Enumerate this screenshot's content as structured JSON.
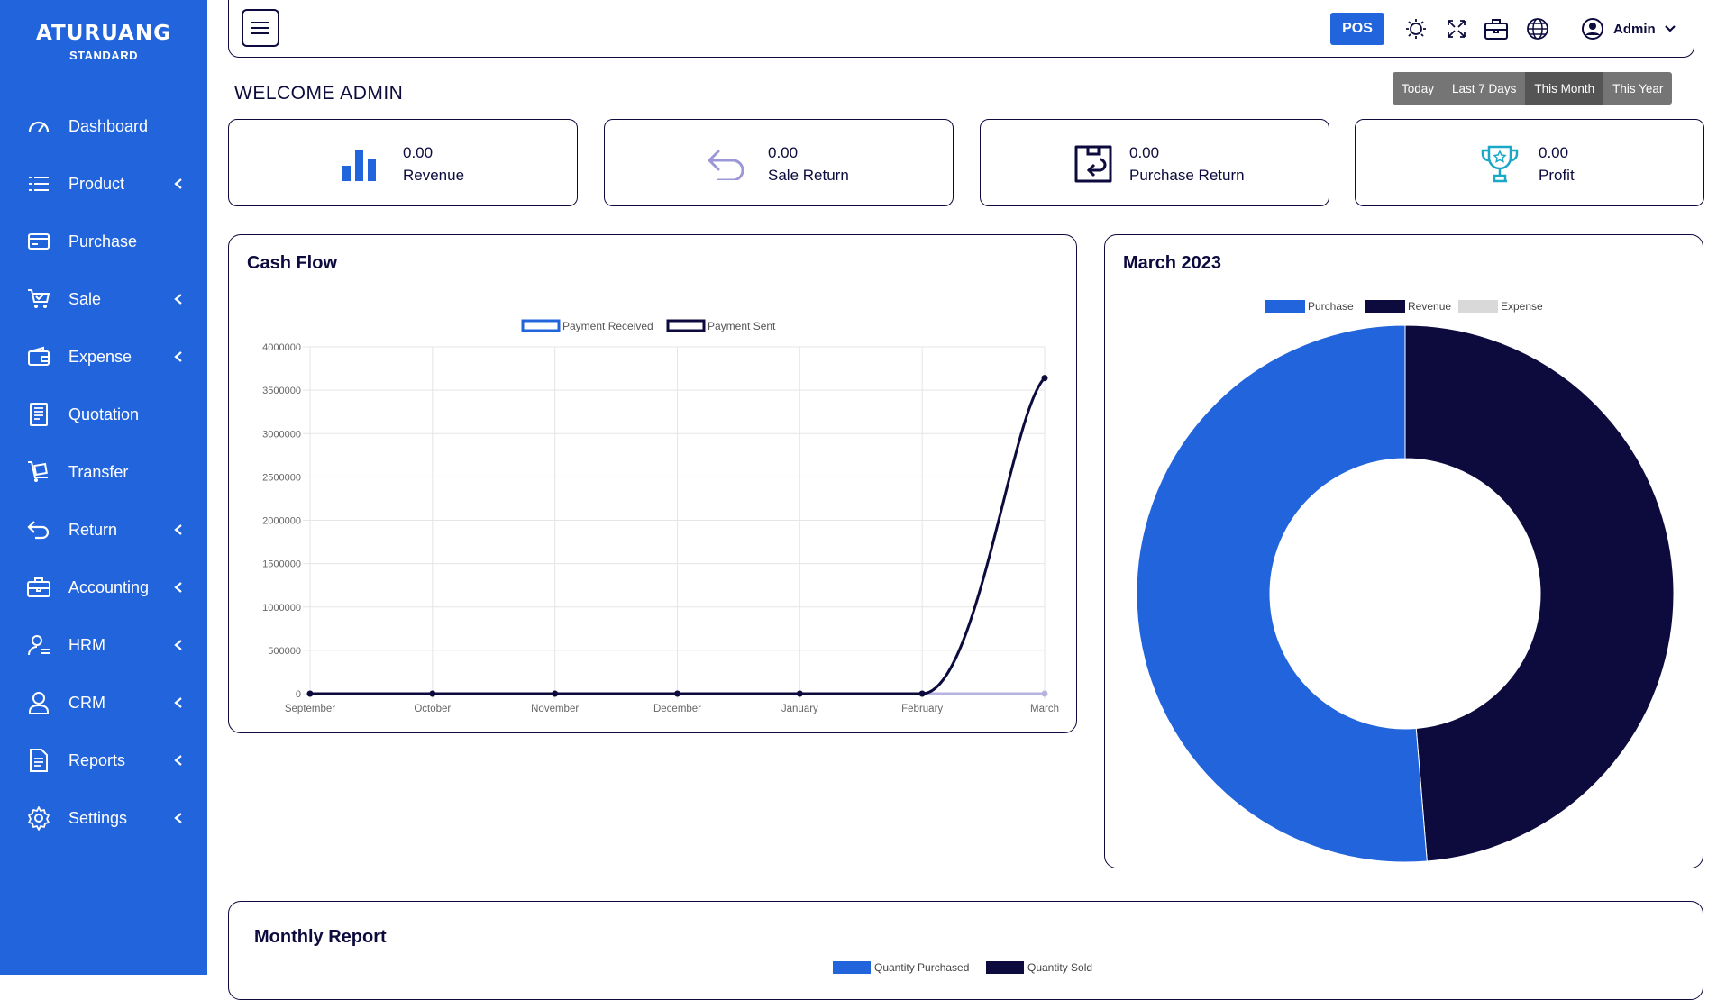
{
  "brand": {
    "name": "ATURUANG",
    "edition": "STANDARD"
  },
  "sidebar": {
    "items": [
      {
        "label": "Dashboard",
        "icon": "gauge-icon",
        "has_submenu": false
      },
      {
        "label": "Product",
        "icon": "list-icon",
        "has_submenu": true
      },
      {
        "label": "Purchase",
        "icon": "card-icon",
        "has_submenu": false
      },
      {
        "label": "Sale",
        "icon": "cart-icon",
        "has_submenu": true
      },
      {
        "label": "Expense",
        "icon": "wallet-icon",
        "has_submenu": true
      },
      {
        "label": "Quotation",
        "icon": "document-icon",
        "has_submenu": false
      },
      {
        "label": "Transfer",
        "icon": "trolley-icon",
        "has_submenu": false
      },
      {
        "label": "Return",
        "icon": "return-arrow-icon",
        "has_submenu": true
      },
      {
        "label": "Accounting",
        "icon": "briefcase-icon",
        "has_submenu": true
      },
      {
        "label": "HRM",
        "icon": "user-list-icon",
        "has_submenu": true
      },
      {
        "label": "CRM",
        "icon": "user-icon",
        "has_submenu": true
      },
      {
        "label": "Reports",
        "icon": "report-icon",
        "has_submenu": true
      },
      {
        "label": "Settings",
        "icon": "gear-icon",
        "has_submenu": true
      }
    ]
  },
  "header": {
    "pos_label": "POS",
    "user_name": "Admin"
  },
  "welcome": "WELCOME ADMIN",
  "date_range": {
    "options": [
      "Today",
      "Last 7 Days",
      "This Month",
      "This Year"
    ],
    "selected": "This Month"
  },
  "stats": [
    {
      "value": "0.00",
      "label": "Revenue",
      "icon": "bar-chart-icon"
    },
    {
      "value": "0.00",
      "label": "Sale Return",
      "icon": "return-icon"
    },
    {
      "value": "0.00",
      "label": "Purchase Return",
      "icon": "purchase-return-icon"
    },
    {
      "value": "0.00",
      "label": "Profit",
      "icon": "trophy-icon"
    }
  ],
  "colors": {
    "primary": "#2264dc",
    "navy": "#0d0b3d",
    "expense": "#d9d9d9",
    "received_line": "#b7b3e0"
  },
  "cash_flow": {
    "title": "Cash Flow",
    "chart_data": {
      "type": "line",
      "categories": [
        "September",
        "October",
        "November",
        "December",
        "January",
        "February",
        "March"
      ],
      "series": [
        {
          "name": "Payment Received",
          "values": [
            0,
            0,
            0,
            0,
            0,
            0,
            0
          ]
        },
        {
          "name": "Payment Sent",
          "values": [
            0,
            0,
            0,
            0,
            0,
            0,
            3640000
          ]
        }
      ],
      "ylim": [
        0,
        4000000
      ],
      "yticks": [
        "0",
        "500000",
        "1000000",
        "1500000",
        "2000000",
        "2500000",
        "3000000",
        "3500000",
        "4000000"
      ],
      "grid": true,
      "legend": "top-center"
    }
  },
  "donut": {
    "title": "March 2023",
    "chart_data": {
      "type": "pie",
      "labels": [
        "Purchase",
        "Revenue",
        "Expense"
      ],
      "values": [
        51.3,
        48.7,
        0
      ],
      "legend": "top-center"
    }
  },
  "monthly": {
    "title": "Monthly Report",
    "legend": [
      "Quantity Purchased",
      "Quantity Sold"
    ]
  }
}
